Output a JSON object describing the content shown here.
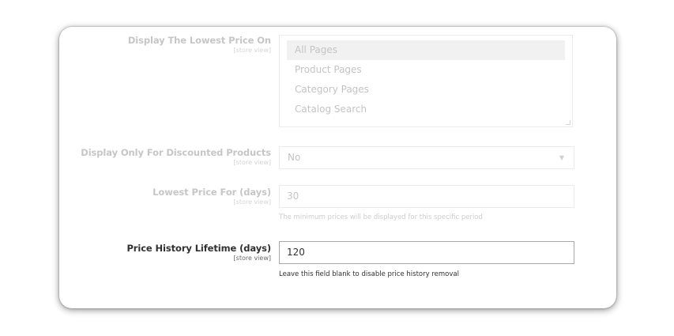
{
  "fields": {
    "lowest_price_on": {
      "label": "Display The Lowest Price On",
      "scope": "[store view]",
      "options": [
        "All Pages",
        "Product Pages",
        "Category Pages",
        "Catalog Search"
      ],
      "selected": "All Pages"
    },
    "discounted_only": {
      "label": "Display Only For Discounted Products",
      "scope": "[store view]",
      "value": "No"
    },
    "lowest_price_days": {
      "label": "Lowest Price For (days)",
      "scope": "[store view]",
      "value": "30",
      "note": "The minimum prices will be displayed for this specific period"
    },
    "history_lifetime": {
      "label": "Price History Lifetime (days)",
      "scope": "[store view]",
      "value": "120",
      "note": "Leave this field blank to disable price history removal"
    }
  },
  "icons": {
    "select_arrow": "▼"
  }
}
